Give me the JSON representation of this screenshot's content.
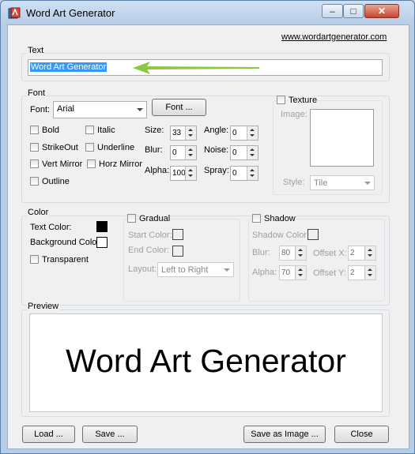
{
  "window": {
    "title": "Word Art Generator",
    "link": "www.wordartgenerator.com"
  },
  "caption_buttons": {
    "minimize": "–",
    "maximize": "□",
    "close": "✕"
  },
  "text_group": {
    "label": "Text",
    "value": "Word Art Generator"
  },
  "font_group": {
    "label": "Font",
    "font_label": "Font:",
    "font_value": "Arial",
    "font_button": "Font ...",
    "checks": {
      "bold": "Bold",
      "italic": "Italic",
      "strikeout": "StrikeOut",
      "underline": "Underline",
      "vert_mirror": "Vert Mirror",
      "horz_mirror": "Horz Mirror",
      "outline": "Outline"
    },
    "size_label": "Size:",
    "size_value": "33",
    "angle_label": "Angle:",
    "angle_value": "0",
    "blur_label": "Blur:",
    "blur_value": "0",
    "noise_label": "Noise:",
    "noise_value": "0",
    "alpha_label": "Alpha:",
    "alpha_value": "100",
    "spray_label": "Spray:",
    "spray_value": "0",
    "texture_label": "Texture",
    "image_label": "Image:",
    "style_label": "Style:",
    "style_value": "Tile"
  },
  "color_group": {
    "label": "Color",
    "text_color_label": "Text Color:",
    "background_color_label": "Background Color",
    "transparent_label": "Transparent",
    "gradual_label": "Gradual",
    "start_color_label": "Start Color:",
    "end_color_label": "End Color:",
    "layout_label": "Layout:",
    "layout_value": "Left to Right",
    "shadow_label": "Shadow",
    "shadow_color_label": "Shadow Color:",
    "blur_label": "Blur:",
    "blur_value": "80",
    "offset_x_label": "Offset X:",
    "offset_x_value": "2",
    "alpha_label": "Alpha:",
    "alpha_value": "70",
    "offset_y_label": "Offset Y:",
    "offset_y_value": "2",
    "text_color": "#000000",
    "background_color": "#ffffff"
  },
  "preview_group": {
    "label": "Preview",
    "text": "Word Art Generator"
  },
  "buttons": {
    "load": "Load ...",
    "save": "Save ...",
    "save_image": "Save as Image ...",
    "close": "Close"
  },
  "colors": {
    "arrow": "#8dc63f",
    "selection": "#3399ff",
    "close_caption": "#c7452f"
  }
}
